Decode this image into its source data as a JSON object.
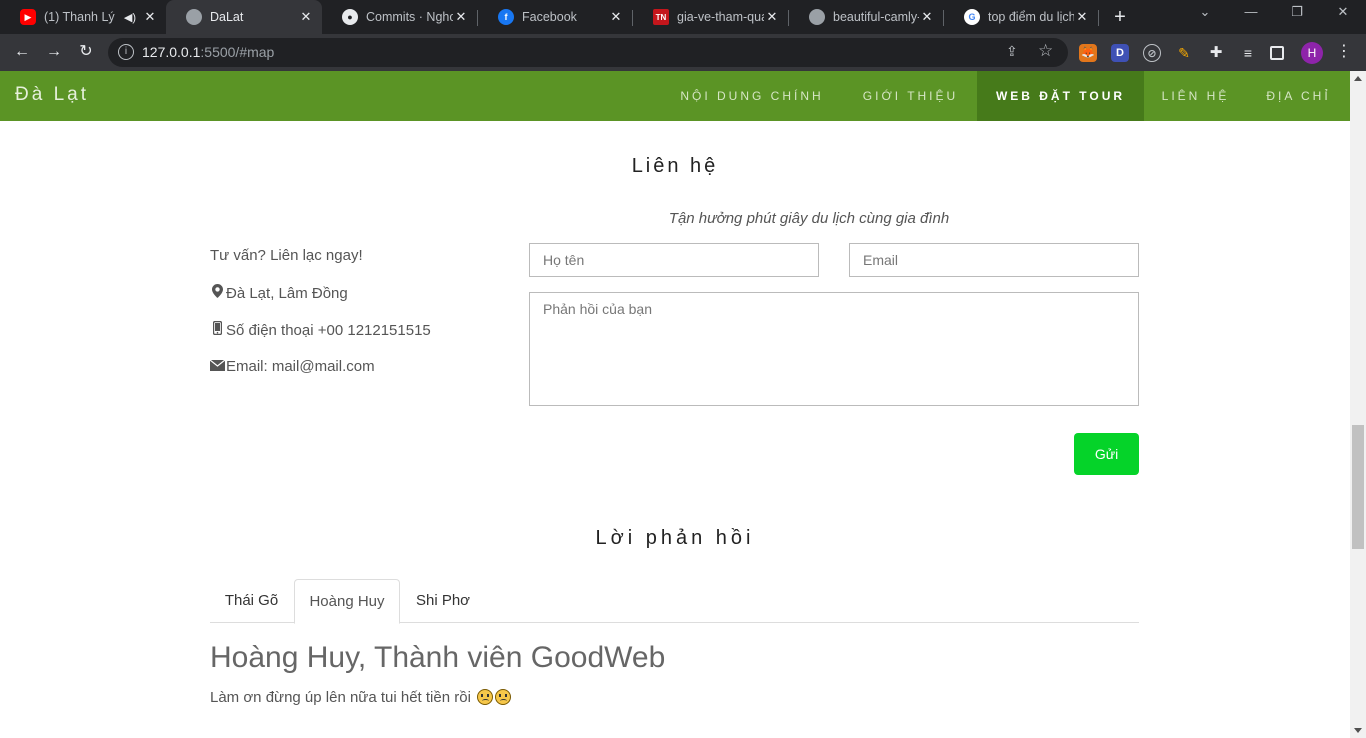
{
  "browser": {
    "tabs": [
      {
        "title": "(1) Thanh Lý",
        "favicon": "youtube-icon"
      },
      {
        "title": "DaLat",
        "favicon": "globe-icon"
      },
      {
        "title": "Commits · Nghoa",
        "favicon": "github-icon"
      },
      {
        "title": "Facebook",
        "favicon": "facebook-icon"
      },
      {
        "title": "gia-ve-tham-qua",
        "favicon": "tn-icon"
      },
      {
        "title": "beautiful-camly-",
        "favicon": "globe-icon"
      },
      {
        "title": "top điểm du lịch",
        "favicon": "google-icon"
      }
    ],
    "url_host": "127.0.0.1",
    "url_rest": ":5500/#map",
    "profile_initial": "H",
    "extension_label": "D"
  },
  "site": {
    "brand": "Đà Lạt",
    "nav": [
      "NỘI DUNG CHÍNH",
      "GIỚI THIỆU",
      "WEB ĐẶT TOUR",
      "LIÊN HỆ",
      "ĐỊA CHỈ"
    ],
    "active_nav": "WEB ĐẶT TOUR",
    "colors": {
      "nav_bg": "#5b9425",
      "nav_active_bg": "#467a1a",
      "send_button": "#05d329"
    }
  },
  "contact": {
    "heading": "Liên hệ",
    "subtitle": "Tận hưởng phút giây du lịch cùng gia đình",
    "prompt": "Tư vấn? Liên lạc ngay!",
    "address": "Đà Lạt, Lâm Đồng",
    "phone": "Số điện thoại +00 1212151515",
    "email": "Email: mail@mail.com",
    "name_placeholder": "Họ tên",
    "email_placeholder": "Email",
    "message_placeholder": "Phản hồi của bạn",
    "send_label": "Gửi"
  },
  "feedback": {
    "heading": "Lời phản hồi",
    "tabs": [
      "Thái Gõ",
      "Hoàng Huy",
      "Shi Phơ"
    ],
    "active_tab": "Hoàng Huy",
    "title": "Hoàng Huy, Thành viên GoodWeb",
    "body": "Làm ơn đừng úp lên nữa tui hết tiền rồi"
  }
}
